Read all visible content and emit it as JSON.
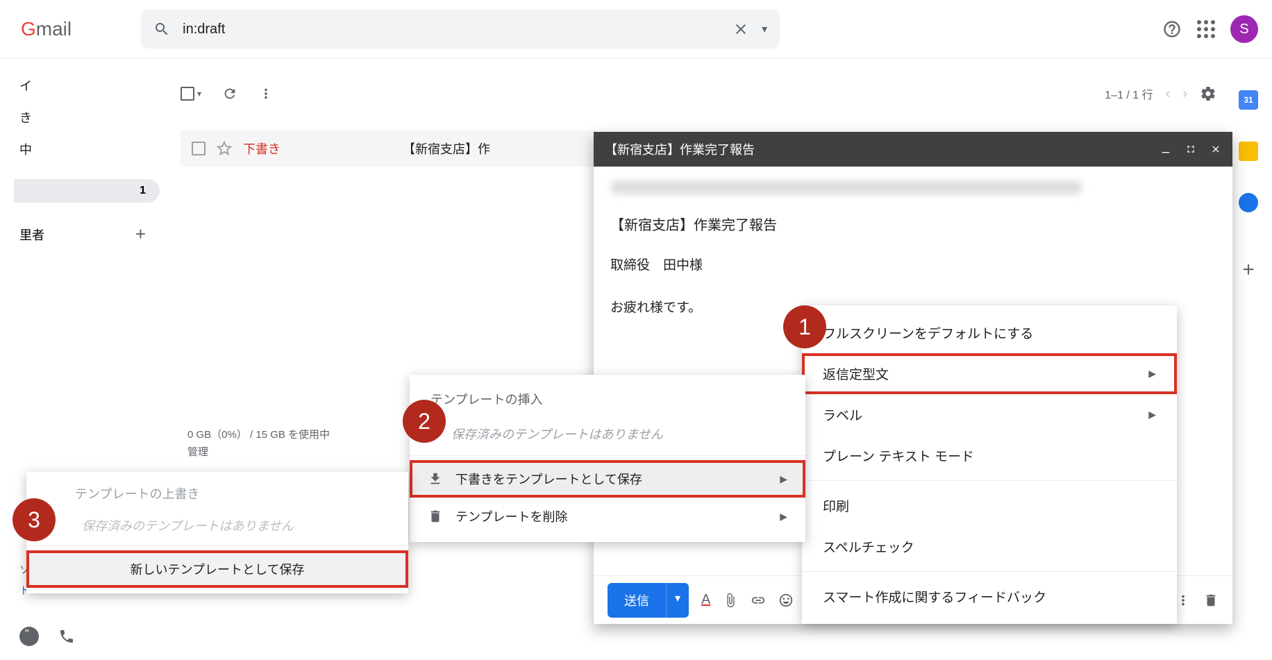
{
  "logo": "Gmail",
  "search": {
    "value": "in:draft"
  },
  "pagination": "1–1 / 1 行",
  "avatar_letter": "S",
  "sidebar": {
    "items": [
      "イ",
      "き",
      "中"
    ],
    "pill_count": "1",
    "manager": "里者"
  },
  "mailrow": {
    "draft_label": "下書き",
    "subject_preview": "【新宿支店】作"
  },
  "storage": {
    "line1": "0 GB（0%） / 15 GB を使用中",
    "line2": "管理"
  },
  "copyright": "ソ",
  "terms": "ト",
  "compose": {
    "title": "【新宿支店】作業完了報告",
    "subject": "【新宿支店】作業完了報告",
    "body_line1": "取締役　田中様",
    "body_line2": "お疲れ様です。",
    "send": "送信"
  },
  "menu1": {
    "fullscreen": "フルスクリーンをデフォルトにする",
    "canned": "返信定型文",
    "label": "ラベル",
    "plain": "プレーン テキスト モード",
    "print": "印刷",
    "spell": "スペルチェック",
    "feedback": "スマート作成に関するフィードバック"
  },
  "menu2": {
    "header": "テンプレートの挿入",
    "empty": "保存済みのテンプレートはありません",
    "save": "下書きをテンプレートとして保存",
    "delete": "テンプレートを削除"
  },
  "menu3": {
    "header": "テンプレートの上書き",
    "empty": "保存済みのテンプレートはありません",
    "new": "新しいテンプレートとして保存"
  },
  "badges": {
    "b1": "1",
    "b2": "2",
    "b3": "3"
  },
  "calendar_day": "31"
}
